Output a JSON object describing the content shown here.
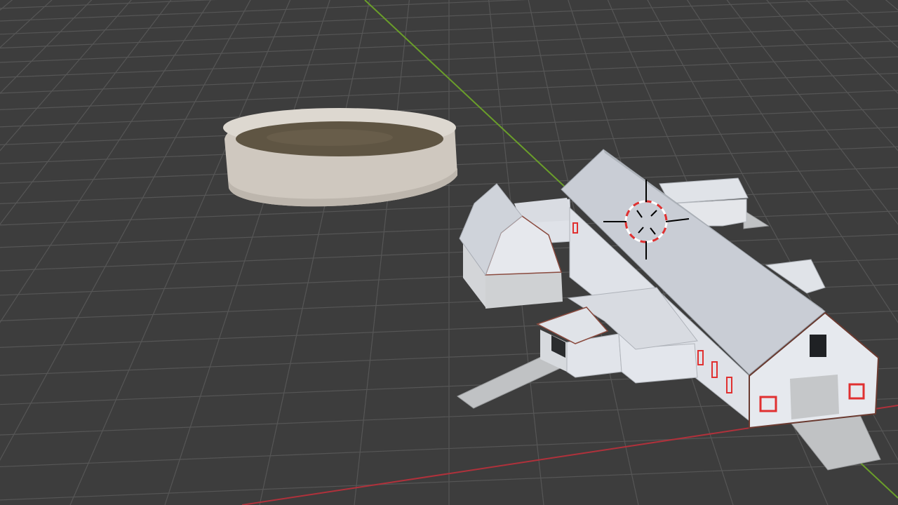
{
  "viewport": {
    "background": "#3d3d3d",
    "grid_color": "#565656",
    "x_axis_color": "#b0313b",
    "y_axis_color": "#6a9e2a"
  },
  "objects": [
    {
      "name": "silo-pit",
      "body": "#d0cac2",
      "fill": "#5f5543"
    },
    {
      "name": "main-barn",
      "roof": "#c9cdd5",
      "walls": "#e3e6ec",
      "trim": "#6a3a30",
      "window_frame": "#e03030"
    },
    {
      "name": "small-barn",
      "roof": "#cfd3da",
      "walls": "#e6e8ed"
    },
    {
      "name": "lean-to-shed",
      "roof": "#d8dbe1",
      "walls": "#e1e4ea"
    },
    {
      "name": "back-shed",
      "roof": "#e0e3e8",
      "walls": "#e4e6ea"
    },
    {
      "name": "concrete-ramps",
      "color": "#c0c2c4"
    }
  ],
  "cursor_3d": {
    "name": "3d-cursor",
    "ring_colors": [
      "#e03030",
      "#ffffff"
    ],
    "crosshair": "#000000"
  }
}
